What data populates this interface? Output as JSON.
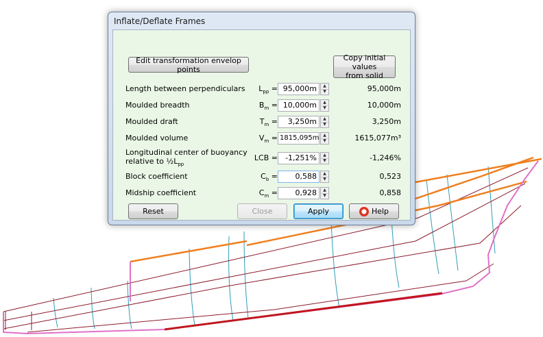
{
  "dialog": {
    "title": "Inflate/Deflate Frames",
    "edit_button": "Edit transformation envelop points",
    "copy_button_line1": "Copy initial values",
    "copy_button_line2": "from solid",
    "rows": [
      {
        "label": "Length between perpendiculars",
        "symbol": "L",
        "sub": "pp",
        "input": "95,000m",
        "initial": "95,000m"
      },
      {
        "label": "Moulded breadth",
        "symbol": "B",
        "sub": "m",
        "input": "10,000m",
        "initial": "10,000m"
      },
      {
        "label": "Moulded draft",
        "symbol": "T",
        "sub": "m",
        "input": "3,250m",
        "initial": "3,250m"
      },
      {
        "label": "Moulded volume",
        "symbol": "V",
        "sub": "m",
        "input": "1815,095m³",
        "initial": "1615,077m³"
      },
      {
        "label": "Longitudinal center of buoyancy",
        "label_line2": "relative to ½L",
        "label_line2_sub": "pp",
        "symbol": "LCB",
        "sub": "",
        "input": "-1,251%",
        "initial": "-1,246%"
      },
      {
        "label": "Block coefficient",
        "symbol": "C",
        "sub": "b",
        "input": "0,588",
        "initial": "0,523"
      },
      {
        "label": "Midship coefficient",
        "symbol": "C",
        "sub": "m",
        "input": "0,928",
        "initial": "0,858"
      }
    ],
    "equals": "=",
    "buttons": {
      "reset": "Reset",
      "close": "Close",
      "apply": "Apply",
      "help": "Help"
    }
  },
  "colors": {
    "frame_lines": "#2e9bb5",
    "waterlines": "#8b1a2a",
    "deck_edge": "#f07f1e",
    "keel": "#c0161e",
    "outline": "#e070c8"
  },
  "icons": {
    "spin_up": "▲",
    "spin_down": "▼"
  }
}
